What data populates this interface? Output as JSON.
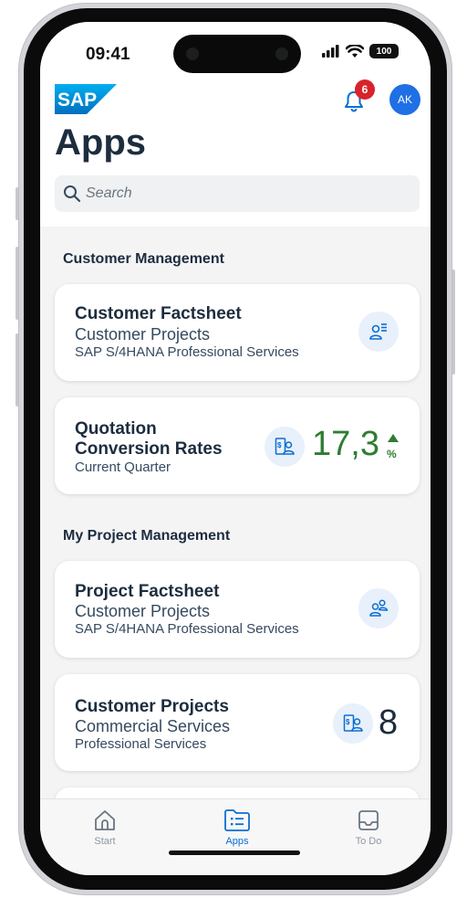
{
  "status": {
    "time": "09:41",
    "battery": "100"
  },
  "header": {
    "logo": "SAP",
    "notification_count": "6",
    "avatar_initials": "AK",
    "title": "Apps"
  },
  "search": {
    "placeholder": "Search"
  },
  "sections": [
    {
      "title": "Customer Management"
    },
    {
      "title": "My Project Management"
    }
  ],
  "cards": {
    "customer_factsheet": {
      "title": "Customer Factsheet",
      "subtitle": "Customer Projects",
      "detail": "SAP S/4HANA Professional Services",
      "icon": "customer-list-icon"
    },
    "quotation": {
      "title_line1": "Quotation",
      "title_line2": "Conversion Rates",
      "subtitle": "Current Quarter",
      "kpi_value": "17,3",
      "kpi_unit": "%",
      "trend": "up",
      "icon": "quotation-icon"
    },
    "project_factsheet": {
      "title": "Project Factsheet",
      "subtitle": "Customer Projects",
      "detail": "SAP S/4HANA Professional Services",
      "icon": "team-icon"
    },
    "customer_projects": {
      "title": "Customer Projects",
      "subtitle": "Commercial Services",
      "detail": "Professional Services",
      "kpi_value": "8",
      "icon": "quotation-icon"
    }
  },
  "tabs": [
    {
      "label": "Start",
      "icon": "home-icon",
      "active": false
    },
    {
      "label": "Apps",
      "icon": "apps-icon",
      "active": true
    },
    {
      "label": "To Do",
      "icon": "inbox-icon",
      "active": false
    }
  ],
  "colors": {
    "accent": "#0a6ed1",
    "kpi_positive": "#2e7d32",
    "badge": "#d8232a"
  }
}
